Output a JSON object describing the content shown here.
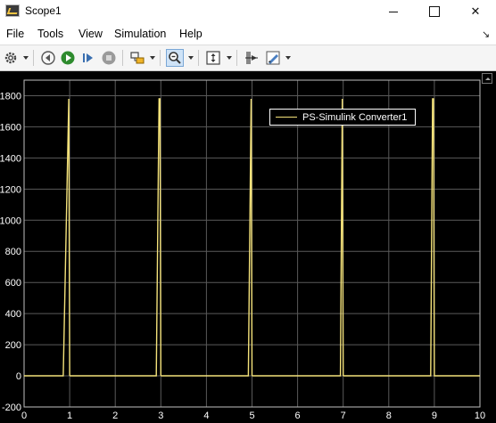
{
  "window": {
    "title": "Scope1"
  },
  "menu": {
    "items": [
      "File",
      "Tools",
      "View",
      "Simulation",
      "Help"
    ]
  },
  "toolbar": {
    "icons": [
      "gear-icon",
      "step-back-icon",
      "run-icon",
      "step-forward-icon",
      "stop-icon",
      "highlight-block-icon",
      "zoom-icon",
      "scale-axes-icon",
      "cursor-measurements-icon",
      "style-icon"
    ]
  },
  "colors": {
    "background": "#000000",
    "grid": "#5a5a5a",
    "signal": "#f4e27a",
    "axis_text": "#ffffff"
  },
  "chart_data": {
    "type": "line",
    "title": "",
    "xlabel": "",
    "ylabel": "",
    "xlim": [
      0,
      10
    ],
    "ylim": [
      -200,
      1900
    ],
    "xticks": [
      "0",
      "1",
      "2",
      "3",
      "4",
      "5",
      "6",
      "7",
      "8",
      "9",
      "10"
    ],
    "yticks": [
      "-200",
      "0",
      "200",
      "400",
      "600",
      "800",
      "1000",
      "1200",
      "1400",
      "1600",
      "1800"
    ],
    "grid": true,
    "legend_position": "top-right",
    "series": [
      {
        "name": "PS-Simulink Converter1",
        "x": [
          0,
          0.86,
          0.98,
          1.0,
          10.0
        ],
        "y": [
          0,
          0,
          1780,
          0,
          0
        ],
        "pulses": [
          {
            "x": [
              0,
              0.86,
              0.98,
              1.0
            ],
            "y": [
              0,
              0,
              1780,
              0
            ]
          },
          {
            "x": [
              1.0,
              2.9,
              2.96,
              2.98,
              3.0
            ],
            "y": [
              0,
              0,
              1780,
              1780,
              0
            ]
          },
          {
            "x": [
              3.0,
              4.92,
              4.98,
              5.0
            ],
            "y": [
              0,
              0,
              1780,
              0
            ]
          },
          {
            "x": [
              5.0,
              6.94,
              6.98,
              7.0
            ],
            "y": [
              0,
              0,
              1780,
              0
            ]
          },
          {
            "x": [
              7.0,
              8.92,
              8.96,
              8.98,
              9.0,
              10.0
            ],
            "y": [
              0,
              0,
              1780,
              1780,
              0,
              0
            ]
          }
        ]
      }
    ]
  }
}
